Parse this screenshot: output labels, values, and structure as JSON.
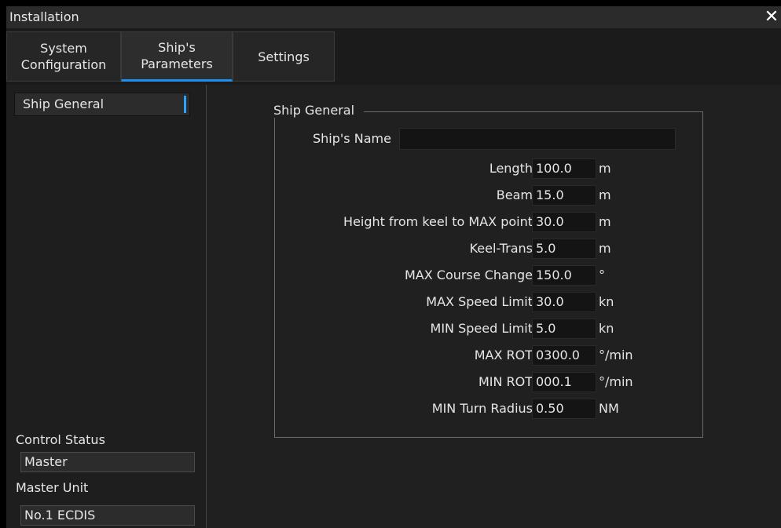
{
  "window": {
    "title": "Installation"
  },
  "tabs": [
    {
      "line1": "System",
      "line2": "Configuration"
    },
    {
      "line1": "Ship's",
      "line2": "Parameters"
    },
    {
      "label": "Settings"
    }
  ],
  "sidebar": {
    "items": [
      {
        "label": "Ship General"
      }
    ],
    "control_status_label": "Control Status",
    "control_status_value": "Master",
    "master_unit_label": "Master Unit",
    "master_unit_value": "No.1 ECDIS"
  },
  "group": {
    "title": "Ship General",
    "ship_name_label": "Ship's Name",
    "ship_name_value": "",
    "fields": [
      {
        "label": "Length",
        "value": "100.0",
        "unit": "m"
      },
      {
        "label": "Beam",
        "value": "15.0",
        "unit": "m"
      },
      {
        "label": "Height from keel to MAX point",
        "value": "30.0",
        "unit": "m"
      },
      {
        "label": "Keel-Trans",
        "value": "5.0",
        "unit": "m"
      },
      {
        "label": "MAX Course Change",
        "value": "150.0",
        "unit": "°"
      },
      {
        "label": "MAX Speed Limit",
        "value": "30.0",
        "unit": "kn"
      },
      {
        "label": "MIN Speed Limit",
        "value": "5.0",
        "unit": "kn"
      },
      {
        "label": "MAX ROT",
        "value": "0300.0",
        "unit": "°/min"
      },
      {
        "label": "MIN ROT",
        "value": "000.1",
        "unit": "°/min"
      },
      {
        "label": "MIN Turn Radius",
        "value": "0.50",
        "unit": "NM"
      }
    ]
  },
  "colors": {
    "accent": "#1f8ef0",
    "background": "#202020",
    "field": "#141414"
  },
  "icons": {
    "close": "close-icon"
  }
}
